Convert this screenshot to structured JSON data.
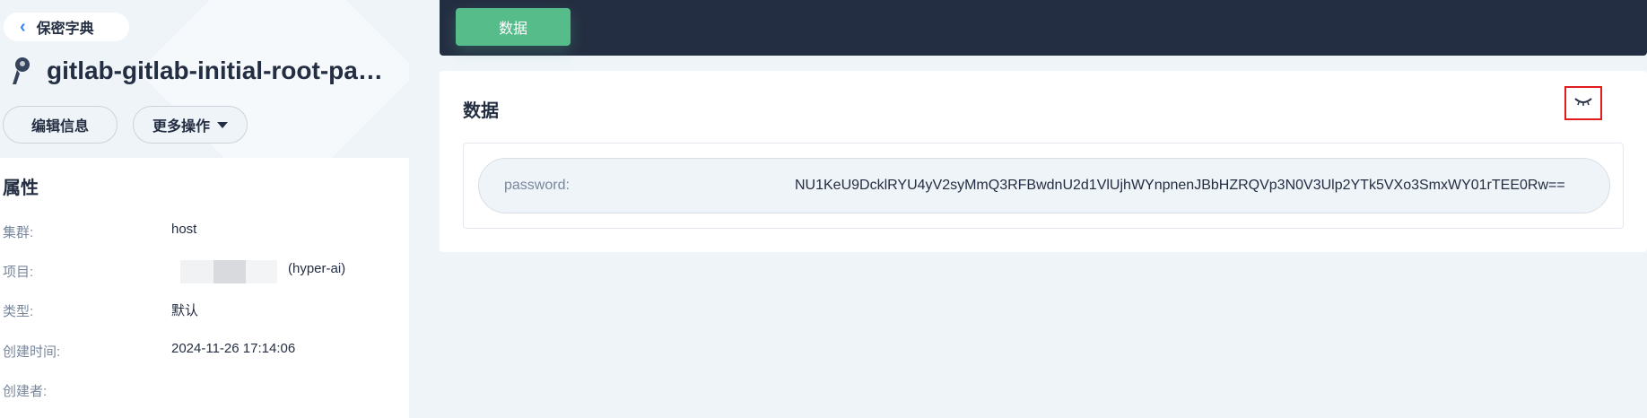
{
  "header": {
    "back_label": "保密字典",
    "title": "gitlab-gitlab-initial-root-pass...",
    "edit_label": "编辑信息",
    "more_label": "更多操作"
  },
  "properties": {
    "section_title": "属性",
    "items": [
      {
        "label": "集群:",
        "value": "host"
      },
      {
        "label": "项目:",
        "value": "(hyper-ai)"
      },
      {
        "label": "类型:",
        "value": "默认"
      },
      {
        "label": "创建时间:",
        "value": "2024-11-26 17:14:06"
      },
      {
        "label": "创建者:",
        "value": ""
      }
    ]
  },
  "tabs": [
    {
      "label": "数据",
      "active": true
    }
  ],
  "data_card": {
    "title": "数据",
    "entries": [
      {
        "key": "password:",
        "value": "NU1KeU9DcklRYU4yV2syMmQ3RFBwdnU2d1VlUjhWYnpnenJBbHZRQVp3N0V3Ulp2YTk5VXo3SmxWY01rTEE0Rw=="
      }
    ]
  },
  "colors": {
    "accent_green": "#55bc8a",
    "dark_bar": "#242e42",
    "highlight_red": "#e01b1b",
    "back_chevron": "#3385ff"
  },
  "icons": {
    "back": "chevron-left-icon",
    "secret": "key-icon",
    "more_caret": "caret-down-icon",
    "toggle": "eye-closed-icon"
  }
}
